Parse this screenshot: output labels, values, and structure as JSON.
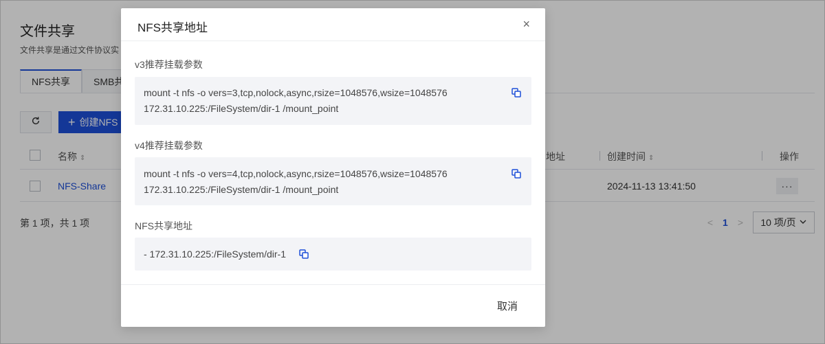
{
  "page": {
    "title": "文件共享",
    "desc": "文件共享是通过文件协议实",
    "tabs": [
      {
        "label": "NFS共享",
        "active": true
      },
      {
        "label": "SMB共"
      }
    ],
    "toolbar": {
      "refresh_icon": "refresh-icon",
      "create_label": "创建NFS"
    },
    "table": {
      "headers": {
        "name": "名称",
        "address": "地址",
        "created": "创建时间",
        "actions": "操作"
      },
      "rows": [
        {
          "name": "NFS-Share",
          "created": "2024-11-13 13:41:50",
          "more": "···"
        }
      ]
    },
    "total": "第 1 项，共 1 项",
    "pager": {
      "current": "1",
      "page_size": "10 项/页"
    }
  },
  "modal": {
    "title": "NFS共享地址",
    "close": "×",
    "v3": {
      "label": "v3推荐挂载参数",
      "line1": "mount -t nfs -o vers=3,tcp,nolock,async,rsize=1048576,wsize=1048576",
      "line2": "172.31.10.225:/FileSystem/dir-1 /mount_point"
    },
    "v4": {
      "label": "v4推荐挂载参数",
      "line1": "mount -t nfs -o vers=4,tcp,nolock,async,rsize=1048576,wsize=1048576",
      "line2": "172.31.10.225:/FileSystem/dir-1 /mount_point"
    },
    "address": {
      "label": "NFS共享地址",
      "value": "- 172.31.10.225:/FileSystem/dir-1"
    },
    "cancel": "取消"
  },
  "colors": {
    "accent": "#1d4fd8",
    "overlay": "rgba(0,0,0,0.30)",
    "code_bg": "#f3f4f7"
  }
}
